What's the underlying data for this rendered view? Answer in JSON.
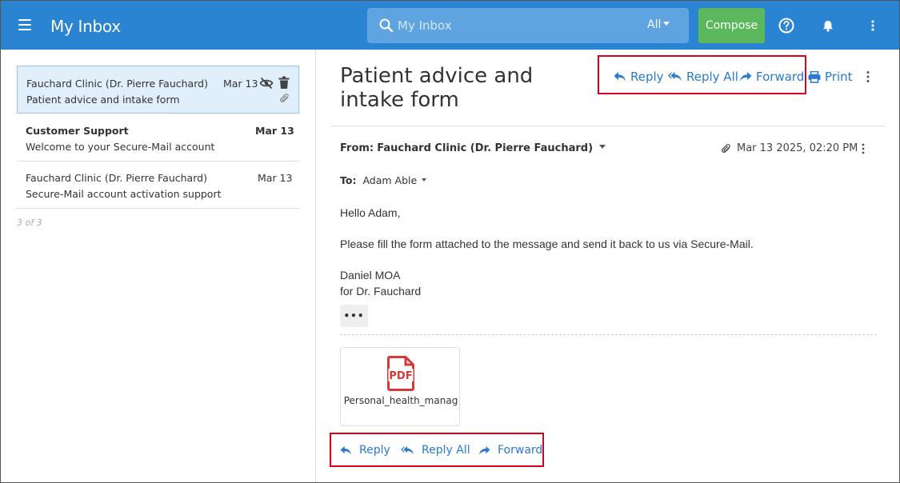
{
  "header": {
    "title": "My Inbox",
    "search_placeholder": "My Inbox",
    "search_scope": "All",
    "compose_label": "Compose",
    "brand_color": "#2a84d2",
    "compose_color": "#5cb85c"
  },
  "message_list": {
    "items": [
      {
        "from": "Fauchard Clinic (Dr. Pierre Fauchard)",
        "subject": "Patient advice and intake form",
        "date": "Mar 13",
        "selected": true,
        "unread": false,
        "has_attachment": true
      },
      {
        "from": "Customer Support",
        "subject": "Welcome to your Secure-Mail account",
        "date": "Mar 13",
        "selected": false,
        "unread": true,
        "has_attachment": false
      },
      {
        "from": "Fauchard Clinic (Dr. Pierre Fauchard)",
        "subject": "Secure-Mail account activation support",
        "date": "Mar 13",
        "selected": false,
        "unread": false,
        "has_attachment": false
      }
    ],
    "count_label": "3 of 3"
  },
  "message": {
    "subject": "Patient advice and intake form",
    "actions": {
      "reply": "Reply",
      "reply_all": "Reply All",
      "forward": "Forward",
      "print": "Print"
    },
    "from_label": "From:",
    "from_name": "Fauchard Clinic (Dr. Pierre Fauchard)",
    "to_label": "To:",
    "to_name": "Adam Able",
    "date": "Mar 13 2025, 02:20 PM",
    "body": {
      "greeting": "Hello Adam,",
      "paragraph": "Please fill the form attached to the message and send it back to us via Secure-Mail.",
      "signature_line1": "Daniel MOA",
      "signature_line2": "for Dr. Fauchard"
    },
    "more_label": "•••",
    "attachment": {
      "name": "Personal_health_manag",
      "type_label": "PDF"
    },
    "highlight_color": "#d9001b"
  }
}
